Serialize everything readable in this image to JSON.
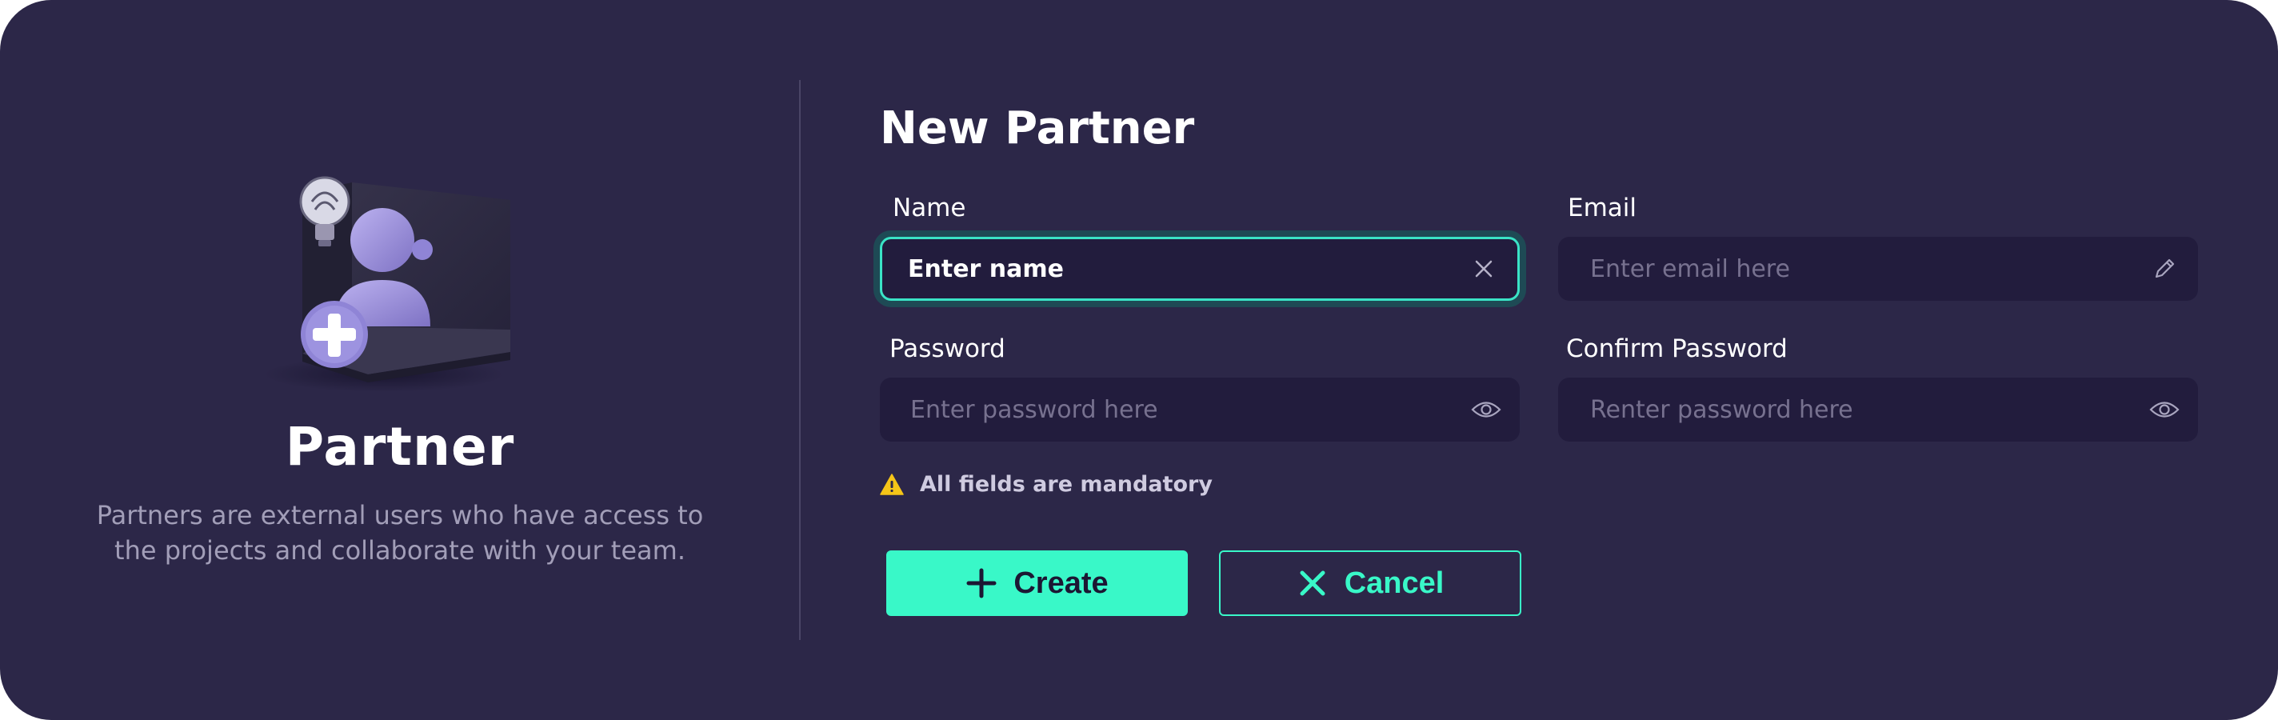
{
  "sidebar": {
    "title": "Partner",
    "description_line1": "Partners are external users who have access to",
    "description_line2": "the projects and collaborate with your team."
  },
  "form": {
    "title": "New Partner",
    "fields": {
      "name": {
        "label": "Name",
        "value": "Enter name",
        "icon": "clear-icon"
      },
      "email": {
        "label": "Email",
        "placeholder": "Enter email here",
        "icon": "pencil-icon"
      },
      "password": {
        "label": "Password",
        "placeholder": "Enter password here",
        "icon": "eye-icon"
      },
      "confirm_password": {
        "label": "Confirm Password",
        "placeholder": "Renter password here",
        "icon": "eye-icon"
      }
    },
    "notice": "All fields are mandatory",
    "create_label": "Create",
    "cancel_label": "Cancel"
  },
  "colors": {
    "background": "#2c2748",
    "input_background": "#221c3d",
    "accent": "#39f8c8",
    "warning": "#f5c518"
  }
}
